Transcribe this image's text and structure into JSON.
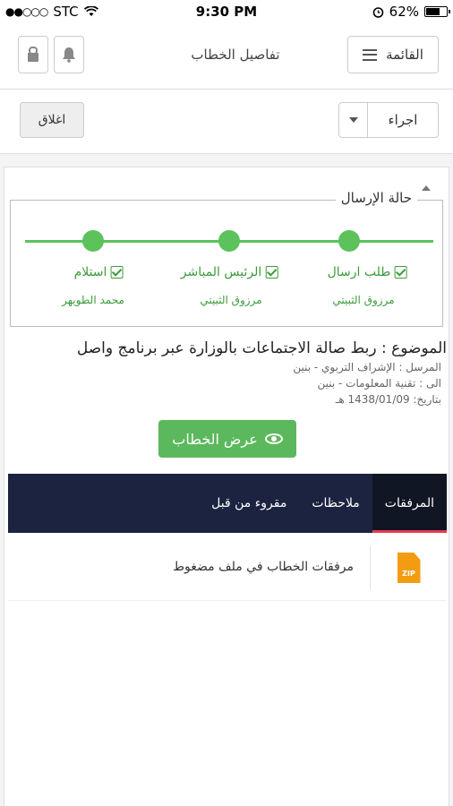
{
  "status_bar": {
    "carrier": "STC",
    "time": "9:30 PM",
    "battery_percent": "62%",
    "battery_level": 0.62
  },
  "header": {
    "menu_label": "القائمة",
    "title": "تفاصيل الخطاب"
  },
  "toolbar": {
    "action_select_value": "اجراء",
    "close_label": "اغلاق"
  },
  "send_status": {
    "legend": "حالة الإرسال",
    "steps": [
      {
        "label": "طلب ارسال",
        "person": "مرزوق الثبيتي",
        "done": true
      },
      {
        "label": "الرئيس المباشر",
        "person": "مرزوق الثبيتي",
        "done": true
      },
      {
        "label": "استلام",
        "person": "محمد الطويهر",
        "done": true
      }
    ]
  },
  "letter": {
    "subject": "الموضوع : ربط صالة الاجتماعات بالوزارة عبر برنامج واصل",
    "sender": "المرسل : الإشراف التربوي - بنين",
    "recipient": "الى : تقنية المعلومات - بنين",
    "date": "بتاريخ: 1438/01/09 هـ",
    "view_button_label": "عرض الخطاب"
  },
  "tabs": [
    {
      "label": "المرفقات",
      "active": true
    },
    {
      "label": "ملاحظات",
      "active": false
    },
    {
      "label": "مقروء من قبل",
      "active": false
    }
  ],
  "attachments": [
    {
      "icon": "zip-file-icon",
      "icon_text": "ZIP",
      "label": "مرفقات الخطاب في ملف مضغوط"
    }
  ],
  "colors": {
    "accent_green": "#5cb85c",
    "tab_bar": "#1c2340",
    "active_tab_underline": "#e53b50",
    "zip_orange": "#f39c12"
  }
}
